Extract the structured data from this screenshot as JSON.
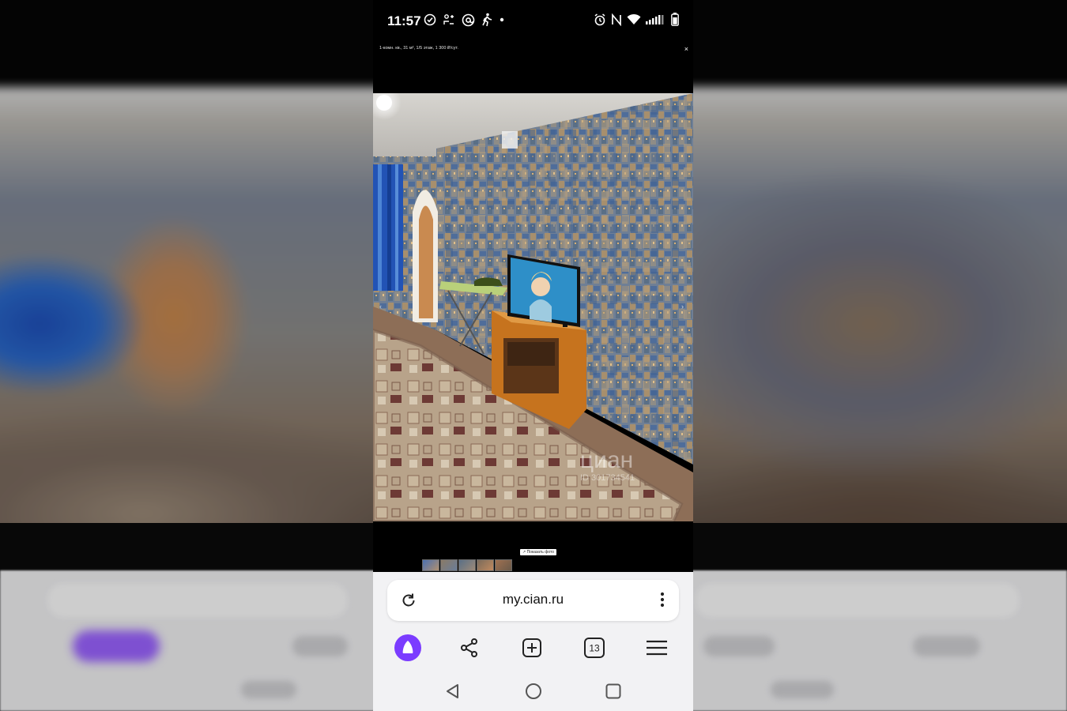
{
  "status_bar": {
    "time": "11:57",
    "left_icons": [
      "check-circle-icon",
      "accessibility-icon",
      "at-icon",
      "walking-icon",
      "dot-icon"
    ],
    "right_icons": [
      "alarm-icon",
      "nfc-icon",
      "wifi-icon",
      "signal-icon",
      "battery-icon"
    ]
  },
  "viewer": {
    "caption": "1-комн. кв., 31 м², 1/5 этаж, 1 300 ₽/сут.",
    "close_label": "×",
    "prev_label": "‹",
    "next_label": "›",
    "watermark": "циан",
    "watermark_id": "ID 301734541",
    "all_photos_label": "↗ Показать фото",
    "thumbnail_count": 5
  },
  "browser": {
    "url": "my.cian.ru",
    "tabs_count": "13",
    "toolbar": [
      "alice-assistant-icon",
      "share-icon",
      "new-tab-icon",
      "tabs-icon",
      "menu-icon"
    ]
  },
  "system_nav": [
    "back-icon",
    "home-icon",
    "recents-icon"
  ],
  "colors": {
    "accent": "#7b3cff",
    "browser_bg": "#f2f2f4",
    "viewer_bg": "#000000"
  }
}
